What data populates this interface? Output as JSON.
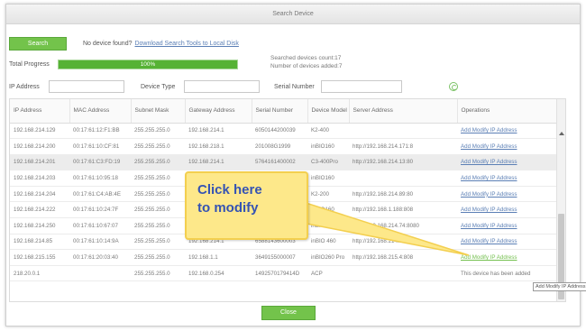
{
  "dialog": {
    "title": "Search Device"
  },
  "search": {
    "button_label": "Search",
    "not_found_text": "No device found?",
    "download_link": "Download Search Tools to Local Disk"
  },
  "progress": {
    "label": "Total Progress",
    "value_text": "100%",
    "value_fraction": 1.0
  },
  "counts": {
    "searched": "Searched devices count:17",
    "added": "Number of devices added:7"
  },
  "filters": {
    "ip_label": "IP Address",
    "ip_value": "",
    "type_label": "Device Type",
    "type_value": "",
    "serial_label": "Serial Number",
    "serial_value": "",
    "refresh_icon": "refresh-icon"
  },
  "table": {
    "headers": [
      "IP Address",
      "MAC Address",
      "Subnet Mask",
      "Gateway Address",
      "Serial Number",
      "Device Model",
      "Server Address",
      "Operations"
    ],
    "rows": [
      {
        "ip": "192.168.214.129",
        "mac": "00:17:61:12:F1:BB",
        "mask": "255.255.255.0",
        "gateway": "192.168.214.1",
        "serial": "6050144200039",
        "model": "K2-400",
        "server": "",
        "op": "Add Modify IP Address",
        "op_style": "link"
      },
      {
        "ip": "192.168.214.200",
        "mac": "00:17:61:10:CF:81",
        "mask": "255.255.255.0",
        "gateway": "192.168.218.1",
        "serial": "201008G1999",
        "model": "inBIO160",
        "server": "http://192.168.214.171:8",
        "op": "Add Modify IP Address",
        "op_style": "link"
      },
      {
        "ip": "192.168.214.201",
        "mac": "00:17:61:C3:FD:19",
        "mask": "255.255.255.0",
        "gateway": "192.168.214.1",
        "serial": "5764161400002",
        "model": "C3-400Pro",
        "server": "http://192.168.214.13:80",
        "op": "Add Modify IP Address",
        "op_style": "link"
      },
      {
        "ip": "192.168.214.203",
        "mac": "00:17:61:10:95:18",
        "mask": "255.255.255.0",
        "gateway": "192.168.214.1",
        "serial": "...29",
        "model": "inBIO160",
        "server": "",
        "op": "Add Modify IP Address",
        "op_style": "link"
      },
      {
        "ip": "192.168.214.204",
        "mac": "00:17:61:C4:AB:4E",
        "mask": "255.255.255.0",
        "gateway": "192.168.214.1",
        "serial": "...300",
        "model": "K2-200",
        "server": "http://192.168.214.89:80",
        "op": "Add Modify IP Address",
        "op_style": "link"
      },
      {
        "ip": "192.168.214.222",
        "mac": "00:17:61:10:24:7F",
        "mask": "255.255.255.0",
        "gateway": "192.168.214.1",
        "serial": "...05",
        "model": "inBIO160",
        "server": "http://192.168.1.188:808",
        "op": "Add Modify IP Address",
        "op_style": "link"
      },
      {
        "ip": "192.168.214.250",
        "mac": "00:17:61:10:67:07",
        "mask": "255.255.255.0",
        "gateway": "192.168.214.1",
        "serial": "6584150400001",
        "model": "inBIO160",
        "server": "http://192.168.214.74:8080",
        "op": "Add Modify IP Address",
        "op_style": "link"
      },
      {
        "ip": "192.168.214.85",
        "mac": "00:17:61:10:14:9A",
        "mask": "255.255.255.0",
        "gateway": "192.168.214.1",
        "serial": "6588143600003",
        "model": "inBIO 460",
        "server": "http://192.168.214.18:80",
        "op": "Add Modify IP Address",
        "op_style": "link"
      },
      {
        "ip": "192.168.215.155",
        "mac": "00:17:61:20:03:40",
        "mask": "255.255.255.0",
        "gateway": "192.168.1.1",
        "serial": "3649155000007",
        "model": "inBIO260 Pro",
        "server": "http://192.168.215.4:808",
        "op": "Add Modify IP Address",
        "op_style": "link green"
      },
      {
        "ip": "218.20.0.1",
        "mac": "",
        "mask": "255.255.255.0",
        "gateway": "192.168.0.254",
        "serial": "1492570179414D",
        "model": "ACP",
        "server": "",
        "op": "This device has been added",
        "op_style": "text"
      }
    ]
  },
  "callout": {
    "line1": "Click here",
    "line2": "to modify"
  },
  "tooltip": {
    "text": "Add Modify IP Address"
  },
  "footer": {
    "close_label": "Close"
  },
  "colors": {
    "accent_green": "#73c34b",
    "link_blue": "#5b7fb5",
    "callout_yellow": "#fde88a",
    "callout_text": "#3553b3"
  }
}
